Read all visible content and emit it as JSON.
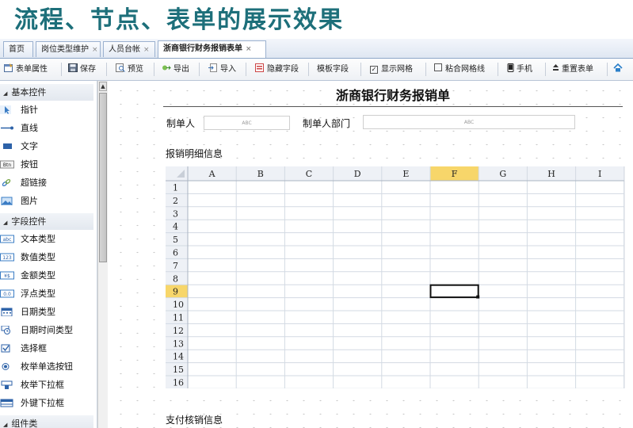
{
  "slide_title": "流程、节点、表单的展示效果",
  "tabs": [
    {
      "label": "首页",
      "closable": false
    },
    {
      "label": "岗位类型维护",
      "closable": true
    },
    {
      "label": "人员台帐",
      "closable": true
    },
    {
      "label": "浙商银行财务报销表单",
      "closable": true,
      "active": true
    }
  ],
  "toolbar": {
    "form_props": "表单属性",
    "save": "保存",
    "preview": "预览",
    "export": "导出",
    "import": "导入",
    "hide_field": "隐藏字段",
    "template_field": "模板字段",
    "show_grid": "显示网格",
    "show_grid_checked": true,
    "snap_grid": "粘合网格线",
    "snap_grid_checked": false,
    "phone": "手机",
    "reset_form": "重置表单"
  },
  "sidebar": {
    "groups": [
      {
        "label": "基本控件",
        "items": [
          {
            "label": "指针",
            "icon": "pointer-icon"
          },
          {
            "label": "直线",
            "icon": "line-icon"
          },
          {
            "label": "文字",
            "icon": "text-icon"
          },
          {
            "label": "按钮",
            "icon": "button-icon"
          },
          {
            "label": "超链接",
            "icon": "link-icon"
          },
          {
            "label": "图片",
            "icon": "image-icon"
          }
        ]
      },
      {
        "label": "字段控件",
        "items": [
          {
            "label": "文本类型",
            "icon": "abc-icon"
          },
          {
            "label": "数值类型",
            "icon": "number-icon"
          },
          {
            "label": "金额类型",
            "icon": "currency-icon"
          },
          {
            "label": "浮点类型",
            "icon": "float-icon"
          },
          {
            "label": "日期类型",
            "icon": "calendar-icon"
          },
          {
            "label": "日期时间类型",
            "icon": "clock-icon"
          },
          {
            "label": "选择框",
            "icon": "checkbox-icon"
          },
          {
            "label": "枚举单选按钮",
            "icon": "radio-icon"
          },
          {
            "label": "枚举下拉框",
            "icon": "dropdown-icon"
          },
          {
            "label": "外键下拉框",
            "icon": "foreign-key-icon"
          }
        ]
      },
      {
        "label": "组件类",
        "items": []
      }
    ]
  },
  "form": {
    "title": "浙商银行财务报销单",
    "maker_label": "制单人",
    "maker_placeholder": "ABC",
    "dept_label": "制单人部门",
    "dept_placeholder": "ABC",
    "detail_label": "报销明细信息",
    "payment_label": "支付核销信息"
  },
  "grid": {
    "columns": [
      "A",
      "B",
      "C",
      "D",
      "E",
      "F",
      "G",
      "H",
      "I"
    ],
    "rows": [
      "1",
      "2",
      "3",
      "4",
      "5",
      "6",
      "7",
      "8",
      "9",
      "10",
      "11",
      "12",
      "13",
      "14",
      "15",
      "16"
    ],
    "selected_column": "F",
    "selected_row": "9"
  },
  "colors": {
    "title": "#1d6f7a",
    "header_selected": "#f7d66a",
    "grid_line": "#d3dae3",
    "header_bg": "#eef1f6"
  }
}
